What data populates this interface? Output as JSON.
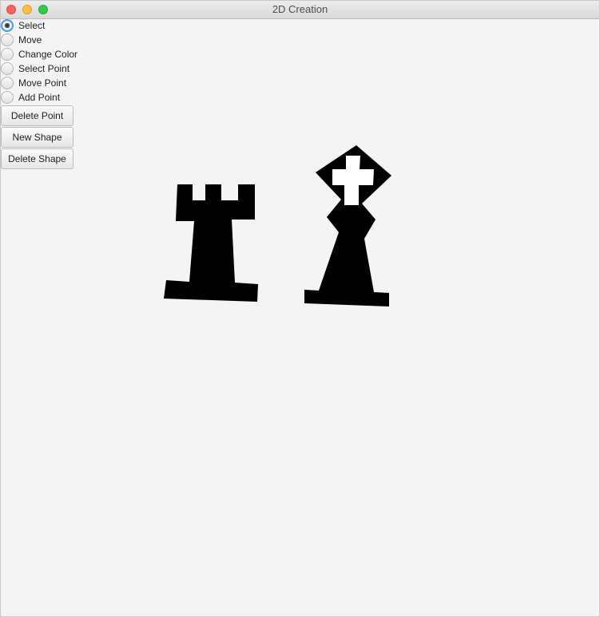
{
  "window": {
    "title": "2D Creation"
  },
  "modes": [
    {
      "label": "Select",
      "selected": true
    },
    {
      "label": "Move",
      "selected": false
    },
    {
      "label": "Change Color",
      "selected": false
    },
    {
      "label": "Select Point",
      "selected": false
    },
    {
      "label": "Move Point",
      "selected": false
    },
    {
      "label": "Add Point",
      "selected": false
    }
  ],
  "buttons": {
    "delete_point": "Delete Point",
    "new_shape": "New Shape",
    "delete_shape": "Delete Shape"
  },
  "canvas": {
    "shapes": [
      {
        "name": "rook",
        "fill": "#000000"
      },
      {
        "name": "bishop",
        "fill": "#000000"
      },
      {
        "name": "bishop-cross",
        "fill": "#ffffff"
      }
    ]
  }
}
